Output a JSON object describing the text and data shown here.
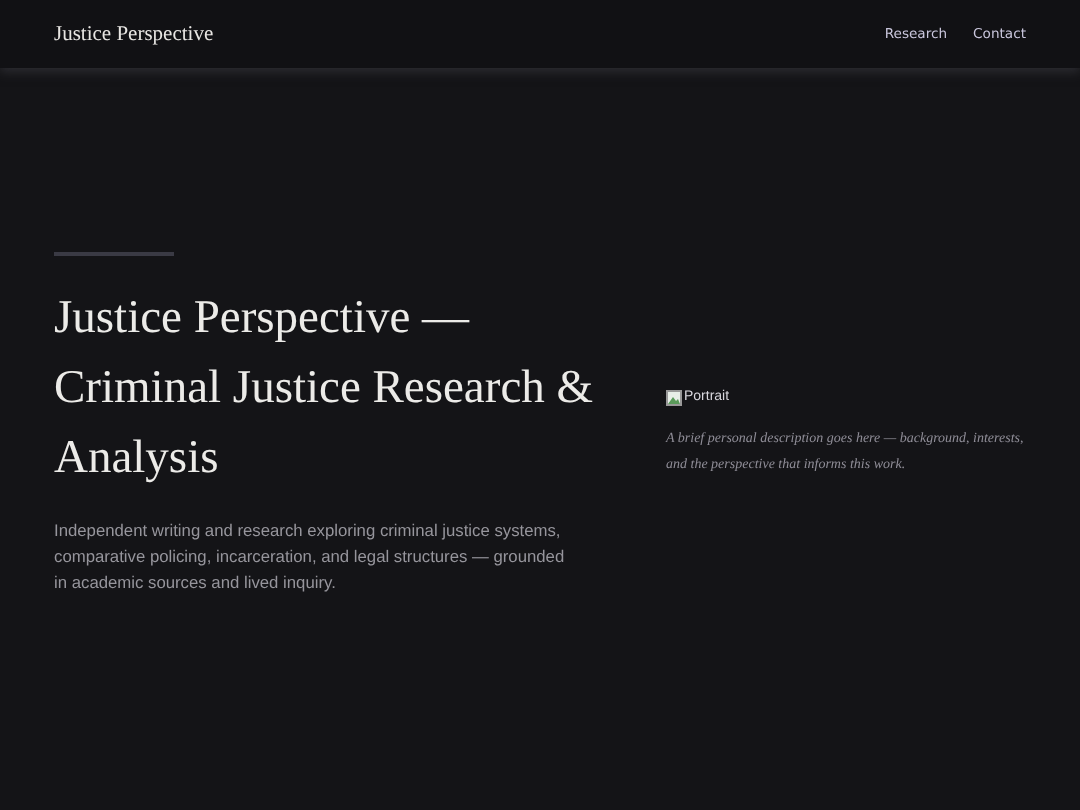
{
  "header": {
    "brand": "Justice Perspective",
    "nav": [
      {
        "label": "Research"
      },
      {
        "label": "Contact"
      }
    ]
  },
  "hero": {
    "title": "Justice Perspective — Criminal Justice Research & Analysis",
    "lead": "Independent writing and research exploring criminal justice systems, comparative policing, incarceration, and legal structures — grounded in academic sources and lived inquiry."
  },
  "profile": {
    "image_alt": "Portrait",
    "description": "A brief personal description goes here — background, interests, and the perspective that informs this work."
  }
}
